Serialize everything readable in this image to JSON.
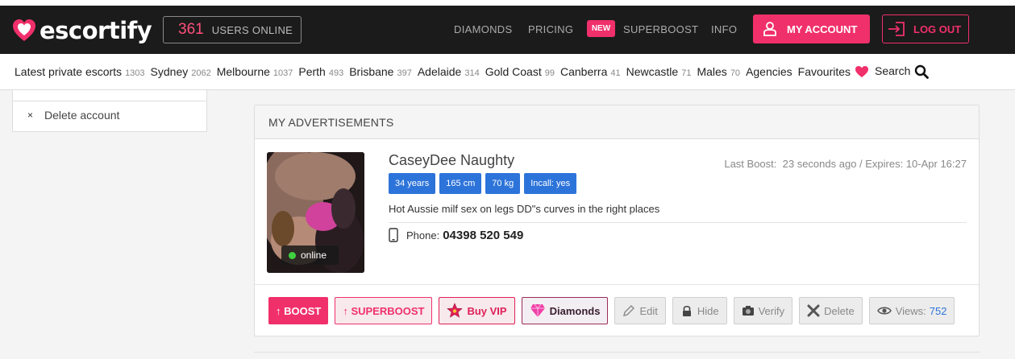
{
  "brand": {
    "name": "escortify",
    "accent": "#f0306b"
  },
  "topbar": {
    "users_online_count": "361",
    "users_online_label": "USERS ONLINE",
    "nav": {
      "diamonds": "DIAMONDS",
      "pricing": "PRICING",
      "new_badge": "NEW",
      "superboost": "SUPERBOOST",
      "info": "INFO"
    },
    "my_account": "MY ACCOUNT",
    "log_out": "LOG OUT"
  },
  "subnav": {
    "items": [
      {
        "label": "Latest private escorts",
        "count": "1303"
      },
      {
        "label": "Sydney",
        "count": "2062"
      },
      {
        "label": "Melbourne",
        "count": "1037"
      },
      {
        "label": "Perth",
        "count": "493"
      },
      {
        "label": "Brisbane",
        "count": "397"
      },
      {
        "label": "Adelaide",
        "count": "314"
      },
      {
        "label": "Gold Coast",
        "count": "99"
      },
      {
        "label": "Canberra",
        "count": "41"
      },
      {
        "label": "Newcastle",
        "count": "71"
      },
      {
        "label": "Males",
        "count": "70"
      }
    ],
    "agencies": "Agencies",
    "favourites": "Favourites",
    "search": "Search"
  },
  "sidebar": {
    "delete_account_icon": "×",
    "delete_account": "Delete account"
  },
  "panel": {
    "title": "MY ADVERTISEMENTS",
    "ad": {
      "name": "CaseyDee Naughty",
      "online_status": "online",
      "last_boost_label": "Last Boost:",
      "last_boost_value": "23 seconds ago / Expires: 10-Apr 16:27",
      "tags": [
        "34 years",
        "165 cm",
        "70 kg",
        "Incall: yes"
      ],
      "description": "Hot Aussie milf sex on legs DD\"s curves in the right places",
      "phone_label": "Phone:",
      "phone_number": "04398 520 549"
    },
    "actions": {
      "boost": "↑ BOOST",
      "superboost": "↑ SUPERBOOST",
      "buy_vip": "Buy VIP",
      "diamonds": "Diamonds",
      "edit": "Edit",
      "hide": "Hide",
      "verify": "Verify",
      "delete": "Delete",
      "views_label": "Views:",
      "views_count": "752"
    }
  }
}
